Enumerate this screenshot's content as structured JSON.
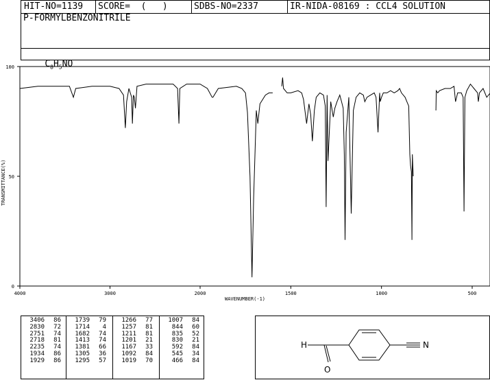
{
  "header": {
    "hit_no": "HIT-NO=1139",
    "score": "SCORE=  (   )",
    "sdbs_no": "SDBS-NO=2337",
    "ir_info": "IR-NIDA-08169 : CCL4 SOLUTION"
  },
  "compound_name": "P-FORMYLBENZONITRILE",
  "formula": {
    "c": "C",
    "c_sub": "8",
    "h": "H",
    "h_sub": "5",
    "rest": "NO"
  },
  "chart_data": {
    "type": "line",
    "xlabel": "WAVENUMBER(-1)",
    "ylabel": "TRANSMITTANCE(%)",
    "xlim": [
      4000,
      400
    ],
    "ylim": [
      0,
      100
    ],
    "x_ticks": [
      "4000",
      "3000",
      "2000",
      "1500",
      "1000",
      "500"
    ],
    "y_ticks": [
      "100",
      "50",
      "0"
    ],
    "grid": false,
    "segments": [
      {
        "x": [
          4000,
          3800,
          3600,
          3450,
          3406,
          3380,
          3200,
          3000,
          2900,
          2850,
          2830,
          2815,
          2790,
          2760,
          2751,
          2740,
          2730,
          2718,
          2700,
          2600,
          2400,
          2300,
          2250,
          2235,
          2225,
          2150,
          2000,
          1960,
          1934,
          1929,
          1900,
          1800,
          1770,
          1750,
          1739,
          1725,
          1714,
          1705,
          1690,
          1682,
          1670,
          1640,
          1620,
          1600
        ],
        "y": [
          90,
          91,
          91,
          91,
          86,
          90,
          91,
          91,
          90,
          87,
          72,
          84,
          90,
          86,
          74,
          87,
          86,
          81,
          91,
          92,
          92,
          92,
          90,
          74,
          90,
          92,
          92,
          90,
          86,
          86,
          90,
          91,
          90,
          88,
          79,
          50,
          4,
          40,
          80,
          74,
          83,
          87,
          88,
          88
        ]
      },
      {
        "x": [
          1550,
          1545,
          1540,
          1520,
          1500,
          1460,
          1440,
          1430,
          1413,
          1400,
          1390,
          1381,
          1370,
          1360,
          1340,
          1320,
          1310,
          1305,
          1300,
          1295,
          1280,
          1266,
          1257,
          1245,
          1230,
          1220,
          1211,
          1205,
          1201,
          1195,
          1180,
          1167,
          1155,
          1140,
          1120,
          1100,
          1092,
          1080,
          1060,
          1040,
          1030,
          1019,
          1010,
          1007,
          1000,
          990,
          970,
          950,
          930,
          910,
          900,
          890,
          870,
          860,
          850,
          844,
          840,
          835,
          832,
          830,
          825
        ],
        "y": [
          91,
          95,
          90,
          88,
          88,
          89,
          88,
          85,
          74,
          83,
          78,
          66,
          80,
          86,
          88,
          87,
          82,
          36,
          87,
          57,
          84,
          77,
          81,
          84,
          87,
          84,
          81,
          60,
          21,
          70,
          86,
          33,
          80,
          86,
          88,
          87,
          84,
          86,
          87,
          88,
          86,
          70,
          88,
          84,
          86,
          88,
          88,
          89,
          88,
          89,
          90,
          88,
          86,
          84,
          82,
          60,
          55,
          52,
          21,
          60,
          50
        ]
      },
      {
        "x": [
          700,
          698,
          690,
          680,
          650,
          620,
          600,
          592,
          580,
          560,
          550,
          545,
          540,
          530,
          510,
          490,
          470,
          466,
          460,
          440,
          420,
          400
        ],
        "y": [
          80,
          89,
          88,
          89,
          90,
          90,
          91,
          84,
          88,
          88,
          86,
          34,
          86,
          89,
          92,
          90,
          88,
          84,
          88,
          90,
          86,
          88
        ]
      }
    ]
  },
  "peak_table": [
    [
      [
        "3406",
        "86"
      ],
      [
        "2830",
        "72"
      ],
      [
        "2751",
        "74"
      ],
      [
        "2718",
        "81"
      ],
      [
        "2235",
        "74"
      ],
      [
        "1934",
        "86"
      ],
      [
        "1929",
        "86"
      ]
    ],
    [
      [
        "1739",
        "79"
      ],
      [
        "1714",
        "4"
      ],
      [
        "1682",
        "74"
      ],
      [
        "1413",
        "74"
      ],
      [
        "1381",
        "66"
      ],
      [
        "1305",
        "36"
      ],
      [
        "1295",
        "57"
      ]
    ],
    [
      [
        "1266",
        "77"
      ],
      [
        "1257",
        "81"
      ],
      [
        "1211",
        "81"
      ],
      [
        "1201",
        "21"
      ],
      [
        "1167",
        "33"
      ],
      [
        "1092",
        "84"
      ],
      [
        "1019",
        "70"
      ]
    ],
    [
      [
        "1007",
        "84"
      ],
      [
        "844",
        "60"
      ],
      [
        "835",
        "52"
      ],
      [
        "830",
        "21"
      ],
      [
        "592",
        "84"
      ],
      [
        "545",
        "34"
      ],
      [
        "466",
        "84"
      ]
    ]
  ],
  "structure": {
    "left_atom": "H",
    "bottom_atom": "O",
    "right_atom": "N"
  }
}
